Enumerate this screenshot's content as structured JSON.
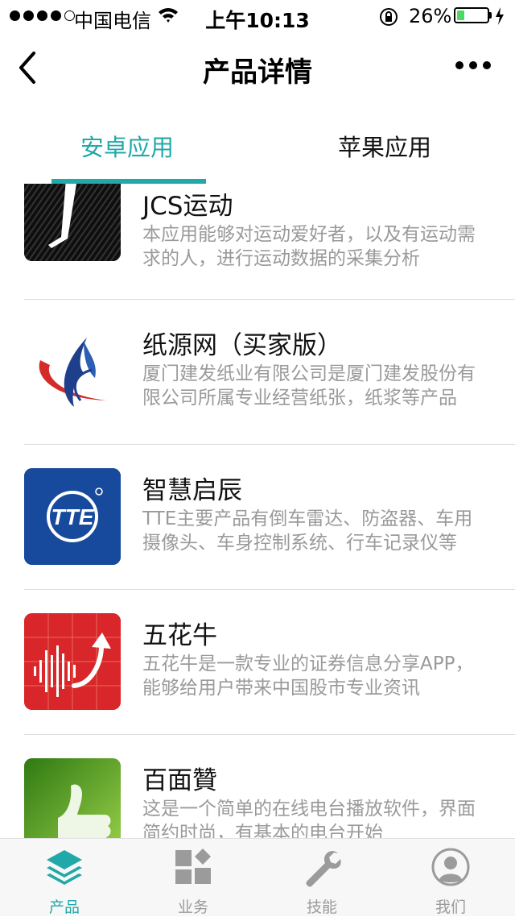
{
  "status_bar": {
    "carrier": "中国电信",
    "time": "上午10:13",
    "battery_percent": "26%",
    "battery_level": 0.26,
    "signal_bars": 4
  },
  "nav": {
    "title": "产品详情",
    "back_icon": "chevron-left-icon",
    "more_icon": "more-horizontal-icon"
  },
  "tabs": [
    {
      "label": "安卓应用",
      "active": true
    },
    {
      "label": "苹果应用",
      "active": false
    }
  ],
  "apps": [
    {
      "title": "JCS运动",
      "description": "本应用能够对运动爱好者，以及有运动需求的人，进行运动数据的采集分析",
      "icon": "jcs-logo-icon"
    },
    {
      "title": "纸源网（买家版）",
      "description": "厦门建发纸业有限公司是厦门建发股份有限公司所属专业经营纸张，纸浆等产品",
      "icon": "paper-logo-icon"
    },
    {
      "title": "智慧启辰",
      "description": "TTE主要产品有倒车雷达、防盗器、车用摄像头、车身控制系统、行车记录仪等",
      "icon": "tte-logo-icon"
    },
    {
      "title": "五花牛",
      "description": "五花牛是一款专业的证券信息分享APP，能够给用户带来中国股市专业资讯",
      "icon": "stock-logo-icon"
    },
    {
      "title": "百面贊",
      "description": "这是一个简单的在线电台播放软件，界面简约时尚，有基本的电台开始",
      "icon": "thumbs-up-logo-icon"
    }
  ],
  "tabbar": [
    {
      "label": "产品",
      "icon": "layers-icon",
      "active": true
    },
    {
      "label": "业务",
      "icon": "grid-icon",
      "active": false
    },
    {
      "label": "技能",
      "icon": "wrench-icon",
      "active": false
    },
    {
      "label": "我们",
      "icon": "user-avatar-icon",
      "active": false
    }
  ],
  "colors": {
    "accent": "#21a8a8",
    "inactive": "#9b9b9b",
    "battery": "#4cd964"
  }
}
